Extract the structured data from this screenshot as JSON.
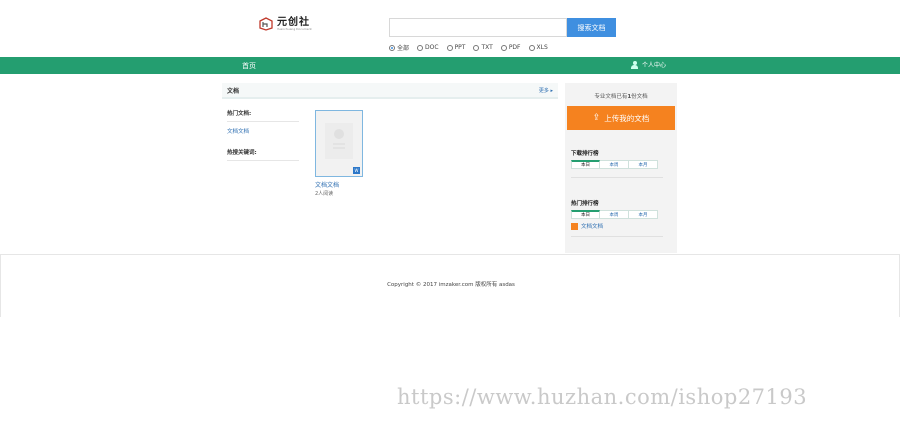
{
  "header": {
    "logo": {
      "name": "元创社",
      "subtitle": "Yuanchuang Document"
    },
    "search": {
      "value": "",
      "placeholder": "",
      "button_label": "搜索文档"
    },
    "filters": [
      {
        "label": "全部",
        "selected": true
      },
      {
        "label": "DOC",
        "selected": false
      },
      {
        "label": "PPT",
        "selected": false
      },
      {
        "label": "TXT",
        "selected": false
      },
      {
        "label": "PDF",
        "selected": false
      },
      {
        "label": "XLS",
        "selected": false
      }
    ]
  },
  "nav": {
    "home_label": "首页",
    "user_label": "个人中心",
    "color": "#249e70"
  },
  "main": {
    "title": "文档",
    "more_label": "更多",
    "hot_docs_title": "热门文档:",
    "hot_docs": [
      {
        "label": "文档文档"
      }
    ],
    "hot_keywords_title": "热搜关键词:",
    "document": {
      "name": "文档文档",
      "views": "2人阅读",
      "badge": "W"
    }
  },
  "sidebar": {
    "tagline": {
      "prefix": "专业文档已有",
      "count": "1",
      "suffix": "份文档"
    },
    "upload_label": "上传我的文档",
    "upload_icon": "upload-icon",
    "upload_color": "#f5821f",
    "download_rank": {
      "title": "下载排行榜",
      "tabs": [
        "本日",
        "本周",
        "本月"
      ],
      "active_tab": 0
    },
    "hot_rank": {
      "title": "热门排行榜",
      "tabs": [
        "本日",
        "本周",
        "本月"
      ],
      "active_tab": 0,
      "items": [
        {
          "label": "文档文档"
        }
      ]
    }
  },
  "footer": {
    "copyright": "Copyright © 2017 imzaker.com 版权所有 asdas"
  },
  "watermark": "https://www.huzhan.com/ishop27193"
}
